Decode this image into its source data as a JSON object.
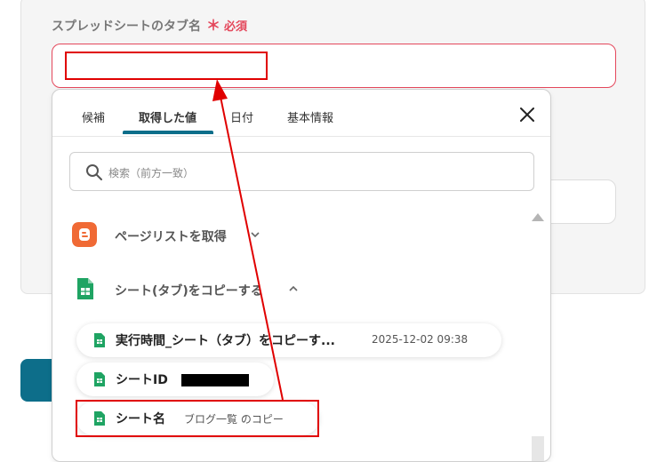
{
  "field": {
    "label": "スプレッドシートのタブ名",
    "required_mark": "＊",
    "required_text": "必須",
    "value": ""
  },
  "dropdown": {
    "tabs": [
      {
        "label": "候補"
      },
      {
        "label": "取得した値"
      },
      {
        "label": "日付"
      },
      {
        "label": "基本情報"
      }
    ],
    "active_tab": "取得した値",
    "search": {
      "placeholder": "検索（前方一致）"
    },
    "groups": [
      {
        "label": "ページリストを取得",
        "icon": "blogger-icon",
        "expanded": false
      },
      {
        "label": "シート(タブ)をコピーする",
        "icon": "google-sheets-icon",
        "expanded": true
      }
    ],
    "values": [
      {
        "label": "実行時間_シート（タブ）をコピーす...",
        "value": "2025-12-02 09:38"
      },
      {
        "label": "シートID",
        "value": ""
      },
      {
        "label": "シート名",
        "value": "ブログ一覧 のコピー"
      }
    ]
  },
  "colors": {
    "accent": "#0d6e8a",
    "required": "#e4475b",
    "annotation": "#e00000",
    "blogger": "#f06a35",
    "sheets": "#1fa463"
  }
}
